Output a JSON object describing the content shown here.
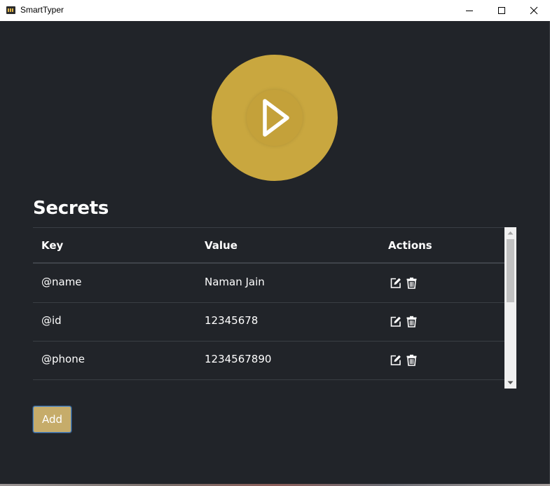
{
  "window": {
    "title": "SmartTyper",
    "app_icon": "keyboard-icon",
    "controls": [
      "minimize-icon",
      "maximize-icon",
      "close-icon"
    ]
  },
  "play": {
    "icon": "play-icon",
    "color": "#c9a73f"
  },
  "secrets": {
    "title": "Secrets",
    "columns": {
      "key": "Key",
      "value": "Value",
      "actions": "Actions"
    },
    "rows": [
      {
        "key": "@name",
        "value": "Naman Jain",
        "actions": [
          "edit-icon",
          "trash-icon"
        ]
      },
      {
        "key": "@id",
        "value": "12345678",
        "actions": [
          "edit-icon",
          "trash-icon"
        ]
      },
      {
        "key": "@phone",
        "value": "1234567890",
        "actions": [
          "edit-icon",
          "trash-icon"
        ]
      }
    ]
  },
  "add_button": {
    "label": "Add",
    "color": "#c6ac6a"
  },
  "theme": {
    "background": "#212429",
    "text": "#ffffff",
    "accent": "#c9a73f"
  }
}
